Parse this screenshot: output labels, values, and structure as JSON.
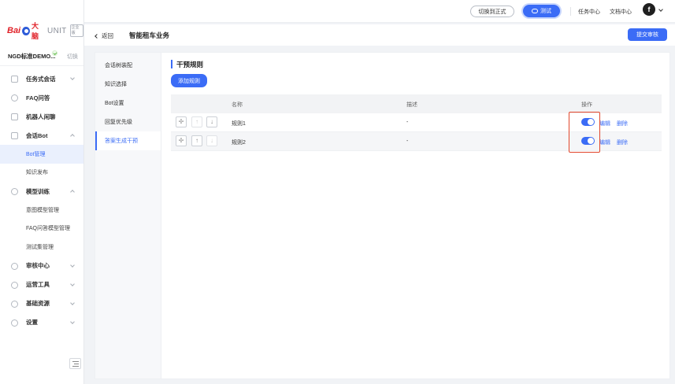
{
  "brand": {
    "logo_bai": "Bai",
    "logo_du": "大脑",
    "logo_unit": "UNIT",
    "logo_badge": "企业版"
  },
  "project": {
    "name": "NGD标准DEMO...",
    "switch_label": "切换"
  },
  "sidebar": {
    "items": [
      {
        "label": "任务式会话",
        "icon": "task-icon",
        "expanded": false
      },
      {
        "label": "FAQ问答",
        "icon": "question-icon"
      },
      {
        "label": "机器人闲聊",
        "icon": "chat-icon"
      },
      {
        "label": "会话Bot",
        "icon": "bot-icon",
        "expanded": true,
        "children": [
          "Bot管理",
          "知识发布"
        ]
      },
      {
        "label": "模型训练",
        "icon": "model-icon",
        "expanded": true,
        "children": [
          "意图模型管理",
          "FAQ问答模型管理",
          "测试集管理"
        ]
      },
      {
        "label": "审核中心",
        "icon": "shield-icon",
        "expanded": false
      },
      {
        "label": "运营工具",
        "icon": "tool-icon",
        "expanded": false
      },
      {
        "label": "基础资源",
        "icon": "resource-icon",
        "expanded": false
      },
      {
        "label": "设置",
        "icon": "settings-icon",
        "expanded": false
      }
    ],
    "active_child": "Bot管理"
  },
  "topbar": {
    "switch_prod": "切换到正式",
    "test": "测试",
    "task_center": "任务中心",
    "doc_center": "文档中心",
    "avatar_letter": "f"
  },
  "header": {
    "back": "返回",
    "title": "智能租车业务",
    "submit": "提交审核"
  },
  "subnav": {
    "items": [
      "会话树装配",
      "知识选择",
      "Bot设置",
      "回复优先级",
      "答案生成干预"
    ],
    "active_index": 4
  },
  "section": {
    "title": "干预规则",
    "add_button": "添加规则"
  },
  "table": {
    "columns": [
      "名称",
      "描述",
      "操作"
    ],
    "rows": [
      {
        "name": "规则1",
        "desc": "-",
        "enabled": true,
        "edit": "编辑",
        "delete": "删除"
      },
      {
        "name": "规则2",
        "desc": "-",
        "enabled": true,
        "edit": "编辑",
        "delete": "删除"
      }
    ]
  },
  "colors": {
    "accent": "#3b6cf6",
    "highlight_box": "#e2462b",
    "brand_red": "#e02128"
  }
}
